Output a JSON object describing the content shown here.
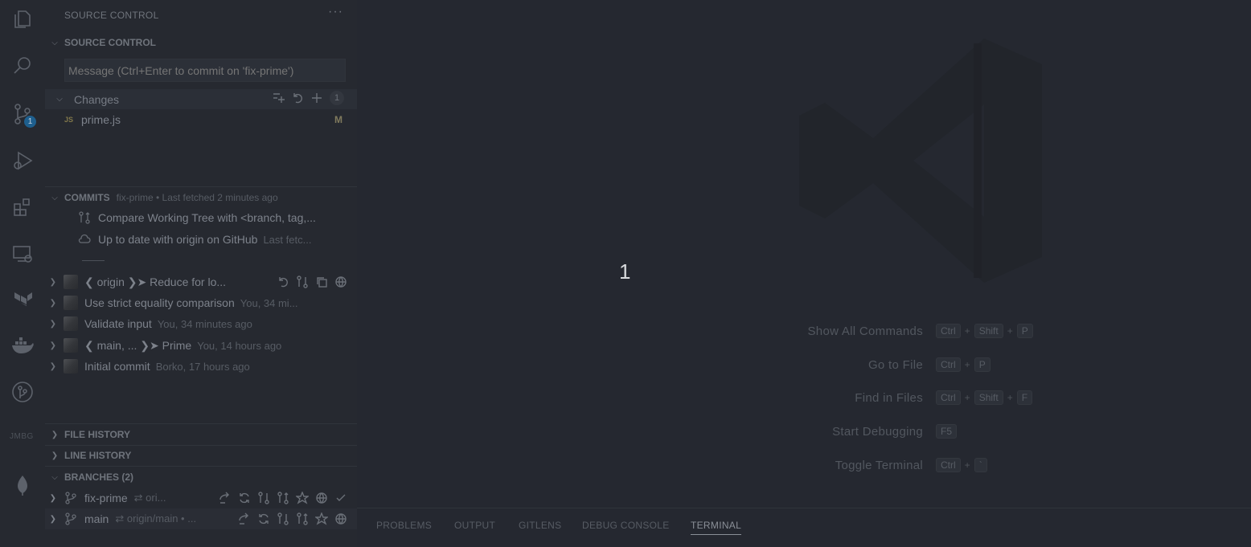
{
  "activity_bar": {
    "scm_badge": "1",
    "bottom_label": "JMBG"
  },
  "sidebar": {
    "title": "SOURCE CONTROL",
    "more": "···",
    "scm_section": "SOURCE CONTROL",
    "commit_placeholder": "Message (Ctrl+Enter to commit on 'fix-prime')",
    "changes_label": "Changes",
    "changes_count": "1",
    "file": {
      "icon_text": "JS",
      "name": "prime.js",
      "status": "M"
    },
    "commits_section": "COMMITS",
    "commits_sub": "fix-prime • Last fetched 2 minutes ago",
    "compare_label": "Compare Working Tree with <branch, tag,...",
    "uptodate_label": "Up to date with origin on GitHub",
    "uptodate_sub": "Last fetc...",
    "commits": [
      {
        "label": "❮ origin ❯➤  Reduce for lo...",
        "sub": ""
      },
      {
        "label": "Use strict equality comparison",
        "sub": "You, 34 mi..."
      },
      {
        "label": "Validate input",
        "sub": "You, 34 minutes ago"
      },
      {
        "label": "❮ main, ... ❯➤  Prime",
        "sub": "You, 14 hours ago"
      },
      {
        "label": "Initial commit",
        "sub": "Borko, 17 hours ago"
      }
    ],
    "file_history": "FILE HISTORY",
    "line_history": "LINE HISTORY",
    "branches_section": "BRANCHES (2)",
    "branches": [
      {
        "name": "fix-prime",
        "track": "⇄ ori..."
      },
      {
        "name": "main",
        "track": "⇄ origin/main  • ..."
      }
    ]
  },
  "editor": {
    "center_text": "1",
    "shortcuts": [
      {
        "label": "Show All Commands",
        "keys": [
          "Ctrl",
          "Shift",
          "P"
        ]
      },
      {
        "label": "Go to File",
        "keys": [
          "Ctrl",
          "P"
        ]
      },
      {
        "label": "Find in Files",
        "keys": [
          "Ctrl",
          "Shift",
          "F"
        ]
      },
      {
        "label": "Start Debugging",
        "keys": [
          "F5"
        ]
      },
      {
        "label": "Toggle Terminal",
        "keys": [
          "Ctrl",
          "`"
        ]
      }
    ]
  },
  "panel": {
    "tabs": [
      "PROBLEMS",
      "OUTPUT",
      "GITLENS",
      "DEBUG CONSOLE",
      "TERMINAL"
    ],
    "active_tab": "TERMINAL"
  }
}
